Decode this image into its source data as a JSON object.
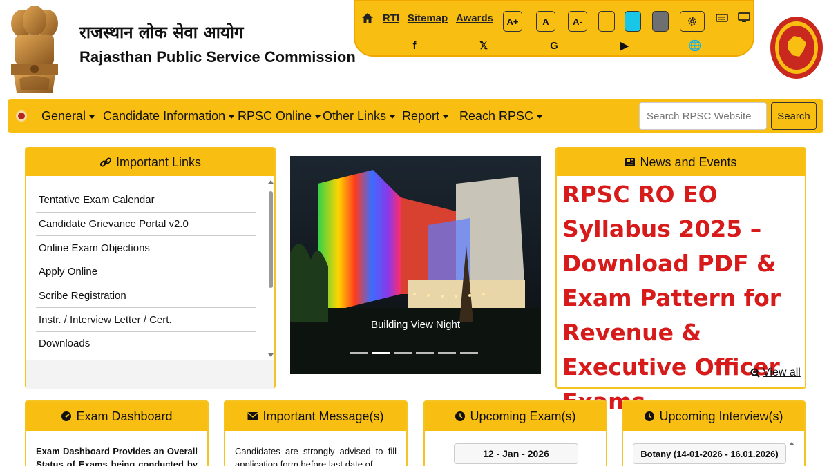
{
  "header": {
    "title_hindi": "राजस्थान लोक सेवा आयोग",
    "title_english": "Rajasthan Public Service Commission"
  },
  "toolbar": {
    "links": [
      "RTI",
      "Sitemap",
      "Awards"
    ],
    "font_buttons": [
      "A+",
      "A",
      "A-"
    ],
    "theme_colors": [
      "#f8bf12",
      "#18c7e8",
      "#6d6f71"
    ],
    "icons": [
      "home-icon",
      "settings-icon",
      "keyboard-icon",
      "desktop-icon"
    ],
    "social_icons": [
      "facebook-icon",
      "x-icon",
      "google-icon",
      "youtube-icon",
      "globe-icon"
    ],
    "social_glyphs": [
      "f",
      "𝕏",
      "G",
      "▶",
      "🌐"
    ]
  },
  "nav": {
    "items": [
      "General",
      "Candidate Information",
      "RPSC Online",
      "Other Links",
      "Report",
      "Reach RPSC"
    ],
    "search_placeholder": "Search RPSC Website",
    "search_button": "Search"
  },
  "important_links": {
    "title": "Important Links",
    "items": [
      "Tentative Exam Calendar",
      "Candidate Grievance Portal v2.0",
      "Online Exam Objections",
      "Apply Online",
      "Scribe Registration",
      "Instr. / Interview Letter / Cert.",
      "Downloads"
    ]
  },
  "carousel": {
    "caption": "Building View Night",
    "slide_count": 6,
    "active_slide": 2
  },
  "news": {
    "title": "News and Events",
    "headline": "RPSC RO EO Syllabus 2025 – Download PDF & Exam Pattern for Revenue & Executive Officer Exams",
    "view_all": "View all"
  },
  "exam_dashboard": {
    "title": "Exam Dashboard",
    "text": "Exam Dashboard Provides an Overall Status of Exams being conducted by the"
  },
  "important_message": {
    "title": "Important Message(s)",
    "text": "Candidates are strongly advised to fill application form before last date of"
  },
  "upcoming_exams": {
    "title": "Upcoming Exam(s)",
    "date": "12 - Jan - 2026"
  },
  "upcoming_interviews": {
    "title": "Upcoming Interview(s)",
    "item": "Botany (14-01-2026 - 16.01.2026)"
  },
  "colors": {
    "accent": "#f8bf12",
    "headline": "#d71a1a"
  }
}
